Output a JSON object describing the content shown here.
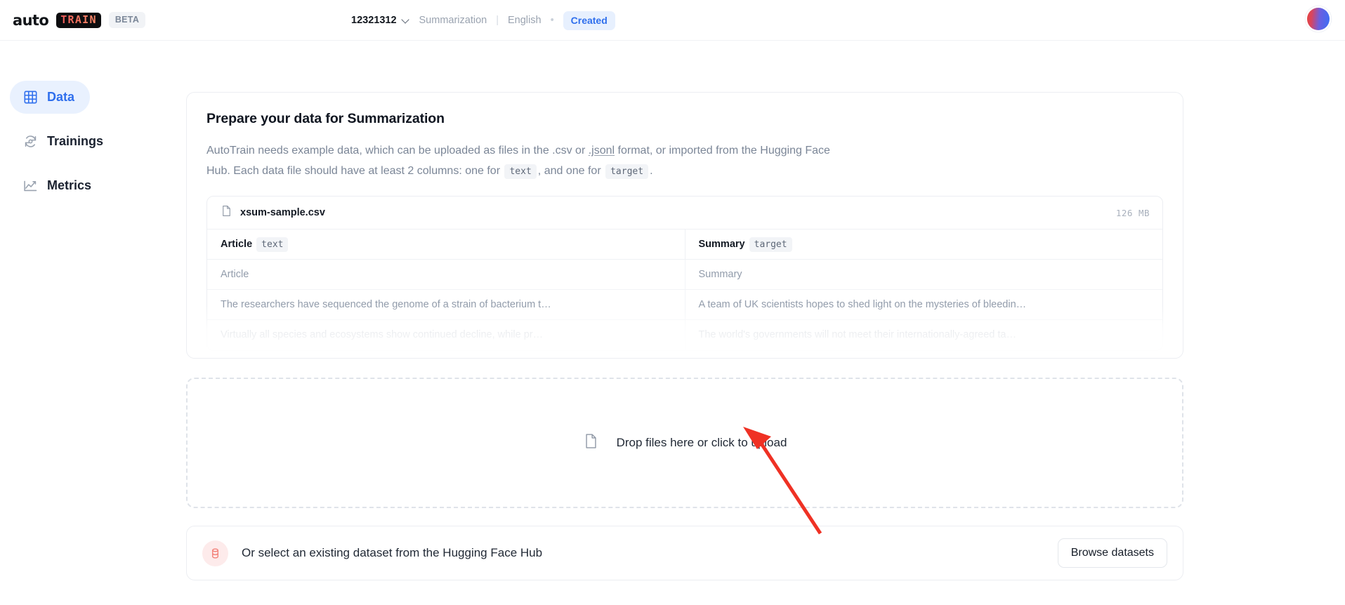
{
  "topbar": {
    "logo_auto": "auto",
    "logo_train": "TRAIN",
    "beta_badge": "BETA",
    "project_name": "12321312",
    "task": "Summarization",
    "separator": "|",
    "language": "English",
    "dot": "•",
    "status": "Created",
    "avatar_name": "user-avatar"
  },
  "sidebar": {
    "items": [
      {
        "label": "Data",
        "icon": "grid-icon",
        "active": true
      },
      {
        "label": "Trainings",
        "icon": "refresh-cycle-icon",
        "active": false
      },
      {
        "label": "Metrics",
        "icon": "line-chart-icon",
        "active": false
      }
    ]
  },
  "main": {
    "title": "Prepare your data for Summarization",
    "desc_1": "AutoTrain needs example data, which can be uploaded as files in the .csv or ",
    "desc_jsonl": ".jsonl",
    "desc_2": " format, or imported from the Hugging Face Hub. Each data file should have at least 2 columns: one for ",
    "code_text": "text",
    "desc_3": ", and one for ",
    "code_target": "target",
    "desc_4": ".",
    "file": {
      "name": "xsum-sample.csv",
      "size": "126 MB",
      "icon": "file-icon"
    },
    "table": {
      "headers": [
        {
          "label": "Article",
          "badge": "text"
        },
        {
          "label": "Summary",
          "badge": "target"
        }
      ],
      "rows": [
        [
          "Article",
          "Summary"
        ],
        [
          "The researchers have sequenced the genome of a strain of bacterium t…",
          "A team of UK scientists hopes to shed light on the mysteries of bleedin…"
        ],
        [
          "Virtually all species and ecosystems show continued decline, while pr…",
          "The world's governments will not meet their internationally-agreed ta…"
        ]
      ]
    },
    "dropzone": {
      "label": "Drop files here or click to upload",
      "icon": "file-icon"
    },
    "hub": {
      "label": "Or select an existing dataset from the Hugging Face Hub",
      "icon": "database-icon",
      "button": "Browse datasets"
    }
  },
  "annotation": {
    "arrow_color": "#ef3124",
    "arrow_name": "red-pointer-arrow"
  },
  "colors": {
    "accent_blue": "#2f6fed",
    "badge_bg": "#e7f0fe",
    "border": "#eceef2",
    "muted_text": "#7b8697"
  }
}
